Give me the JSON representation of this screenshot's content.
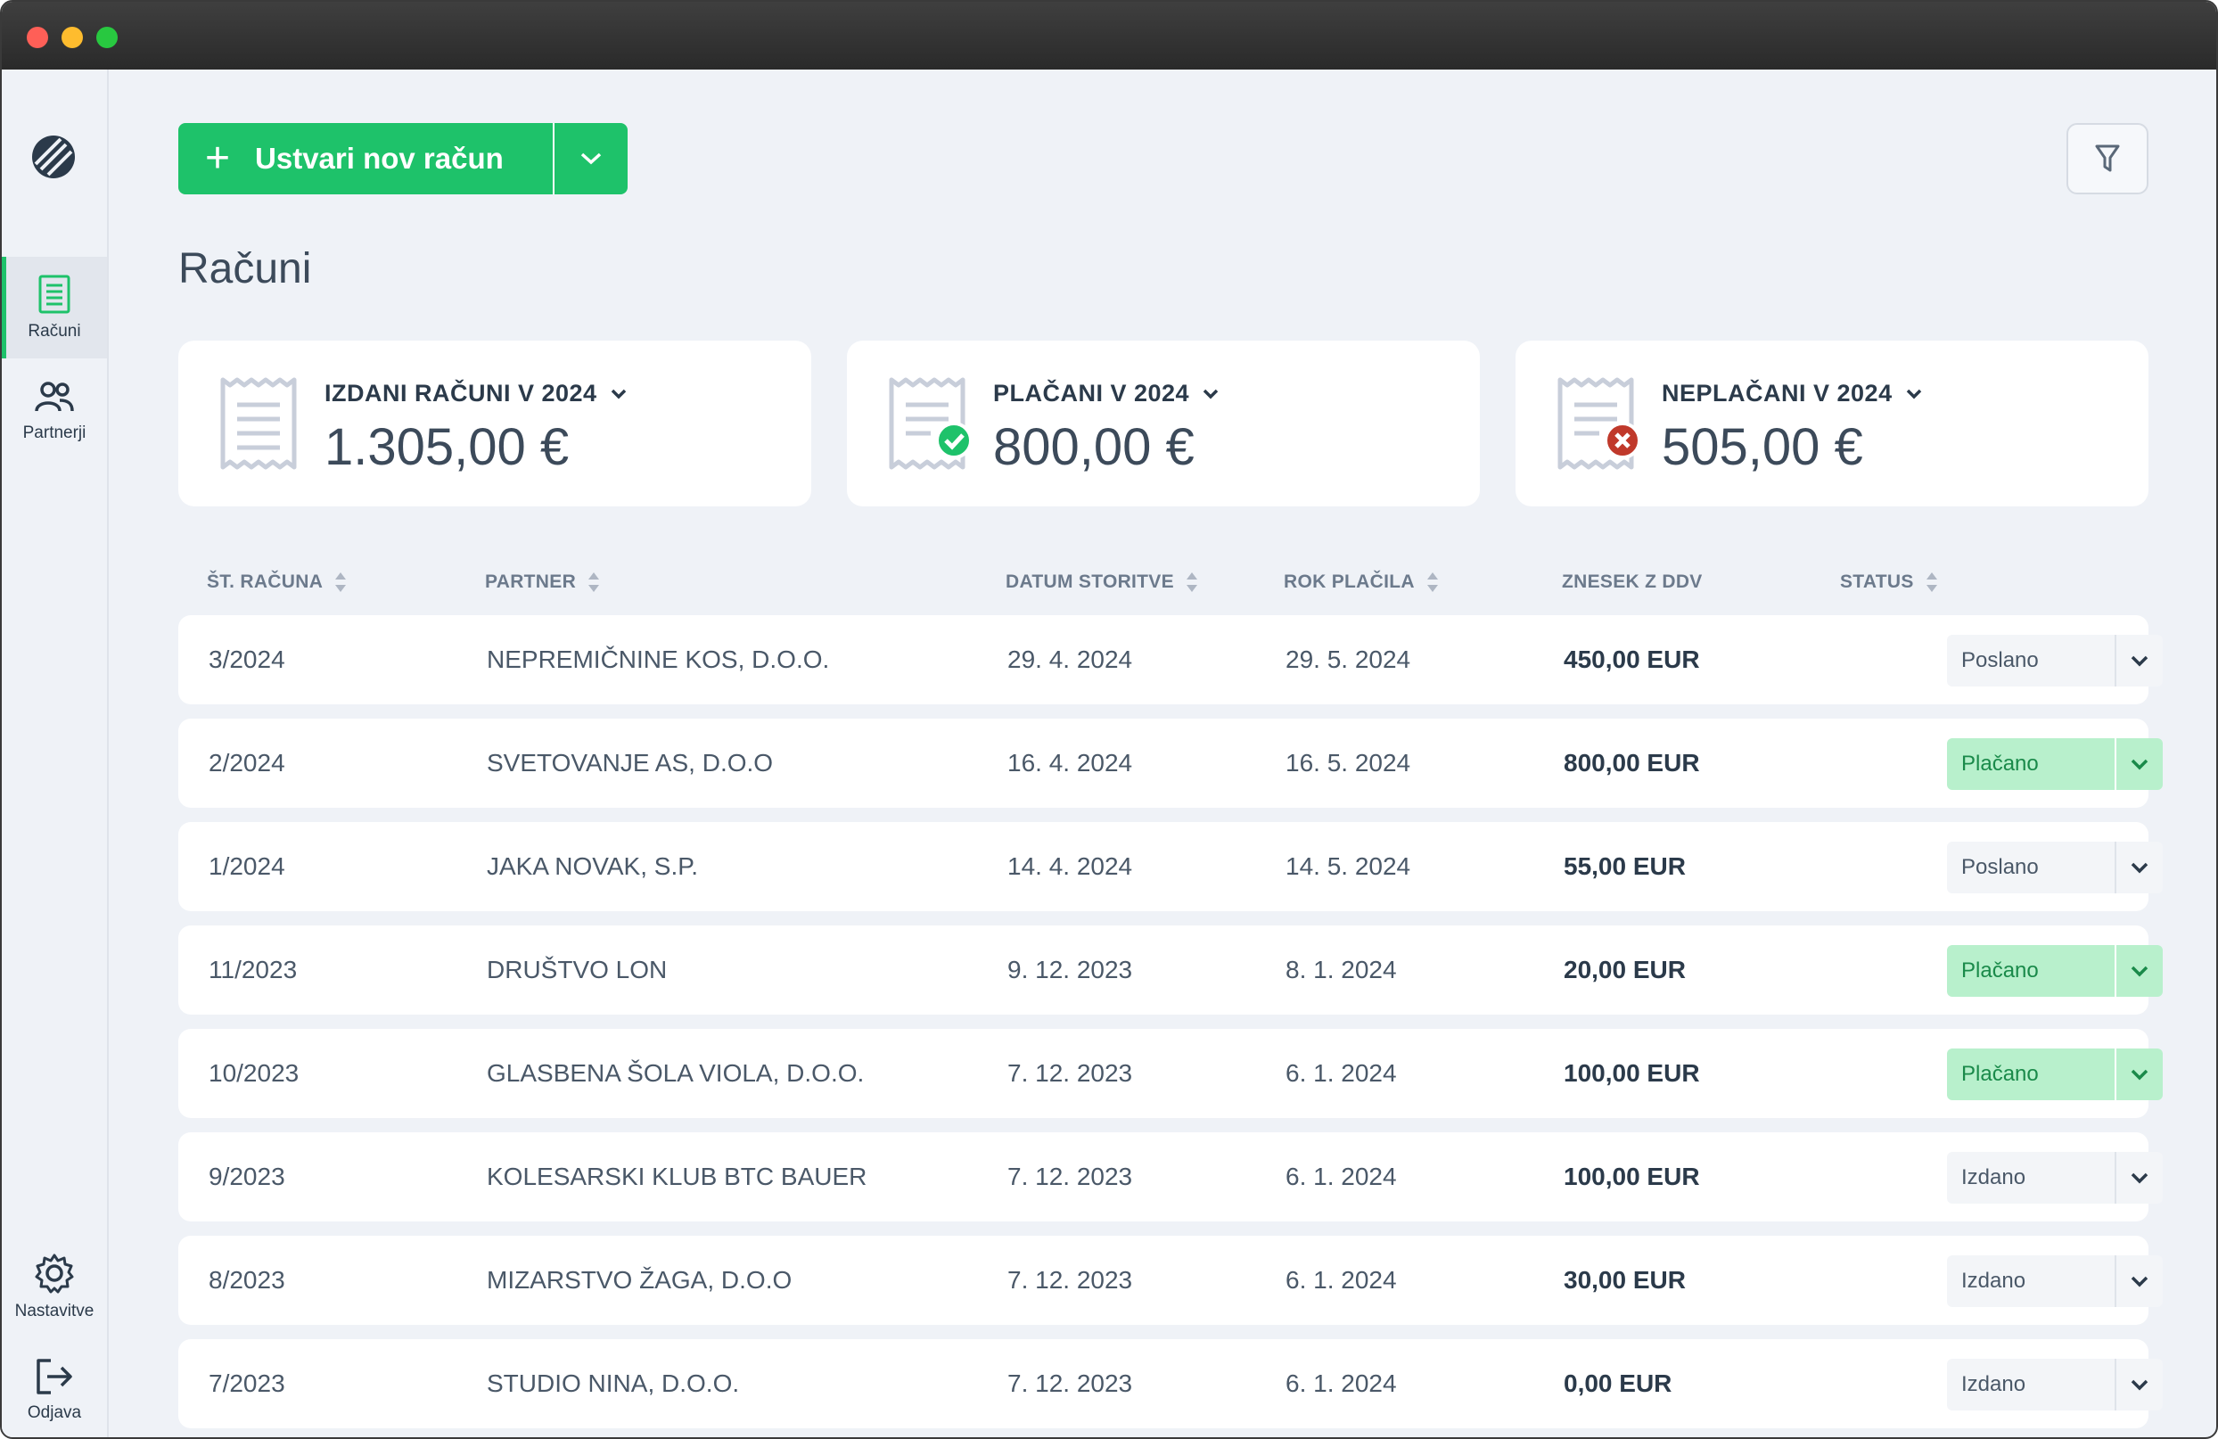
{
  "sidebar": {
    "items": [
      {
        "label": "Računi",
        "icon": "invoice-icon"
      },
      {
        "label": "Partnerji",
        "icon": "partners-icon"
      },
      {
        "label": "Nastavitve",
        "icon": "gear-icon"
      },
      {
        "label": "Odjava",
        "icon": "logout-icon"
      }
    ]
  },
  "toolbar": {
    "create_label": "Ustvari nov račun"
  },
  "page": {
    "title": "Računi"
  },
  "cards": [
    {
      "label": "IZDANI RAČUNI V 2024",
      "value": "1.305,00 €",
      "icon": "receipt-icon"
    },
    {
      "label": "PLAČANI V 2024",
      "value": "800,00 €",
      "icon": "receipt-paid-icon"
    },
    {
      "label": "NEPLAČANI V 2024",
      "value": "505,00 €",
      "icon": "receipt-unpaid-icon"
    }
  ],
  "table": {
    "headers": [
      "ŠT. RAČUNA",
      "PARTNER",
      "DATUM STORITVE",
      "ROK PLAČILA",
      "ZNESEK Z DDV",
      "STATUS"
    ],
    "rows": [
      {
        "number": "3/2024",
        "partner": "NEPREMIČNINE KOS, D.O.O.",
        "service_date": "29. 4. 2024",
        "due_date": "29. 5. 2024",
        "amount": "450,00 EUR",
        "status": "Poslano"
      },
      {
        "number": "2/2024",
        "partner": "SVETOVANJE AS, D.O.O",
        "service_date": "16. 4. 2024",
        "due_date": "16. 5. 2024",
        "amount": "800,00 EUR",
        "status": "Plačano"
      },
      {
        "number": "1/2024",
        "partner": "JAKA NOVAK, S.P.",
        "service_date": "14. 4. 2024",
        "due_date": "14. 5. 2024",
        "amount": "55,00 EUR",
        "status": "Poslano"
      },
      {
        "number": "11/2023",
        "partner": "DRUŠTVO LON",
        "service_date": "9. 12. 2023",
        "due_date": "8. 1. 2024",
        "amount": "20,00 EUR",
        "status": "Plačano"
      },
      {
        "number": "10/2023",
        "partner": "GLASBENA ŠOLA VIOLA, D.O.O.",
        "service_date": "7. 12. 2023",
        "due_date": "6. 1. 2024",
        "amount": "100,00 EUR",
        "status": "Plačano"
      },
      {
        "number": "9/2023",
        "partner": "KOLESARSKI KLUB BTC BAUER",
        "service_date": "7. 12. 2023",
        "due_date": "6. 1. 2024",
        "amount": "100,00 EUR",
        "status": "Izdano"
      },
      {
        "number": "8/2023",
        "partner": "MIZARSTVO ŽAGA, D.O.O",
        "service_date": "7. 12. 2023",
        "due_date": "6. 1. 2024",
        "amount": "30,00 EUR",
        "status": "Izdano"
      },
      {
        "number": "7/2023",
        "partner": "STUDIO NINA, D.O.O.",
        "service_date": "7. 12. 2023",
        "due_date": "6. 1. 2024",
        "amount": "0,00 EUR",
        "status": "Izdano"
      }
    ]
  },
  "colors": {
    "accent": "#1ec26a",
    "paid_bg": "#b8f0cc",
    "unpaid_badge": "#c0392b"
  }
}
